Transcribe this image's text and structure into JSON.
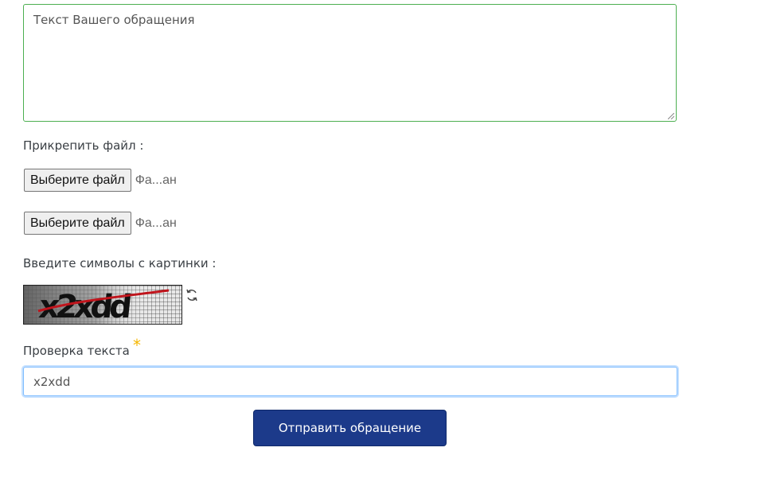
{
  "form": {
    "message_placeholder": "Текст Вашего обращения",
    "attach_label": "Прикрепить файл :",
    "file_inputs": [
      {
        "button_label": "Выберите файл",
        "status": "Фа...ан"
      },
      {
        "button_label": "Выберите файл",
        "status": "Фа...ан"
      }
    ],
    "captcha_label": "Введите символы с картинки :",
    "captcha_text": "x2xdd",
    "check_label": "Проверка текста",
    "required_mark": "*",
    "check_value": "x2xdd",
    "submit_label": "Отправить обращение"
  },
  "colors": {
    "textarea_border": "#4caf50",
    "input_focus": "#80bdff",
    "submit_bg": "#1c3a8a",
    "required_star": "#f5b700"
  },
  "icons": {
    "refresh": "refresh-icon",
    "resize": "resize-grip-icon"
  }
}
